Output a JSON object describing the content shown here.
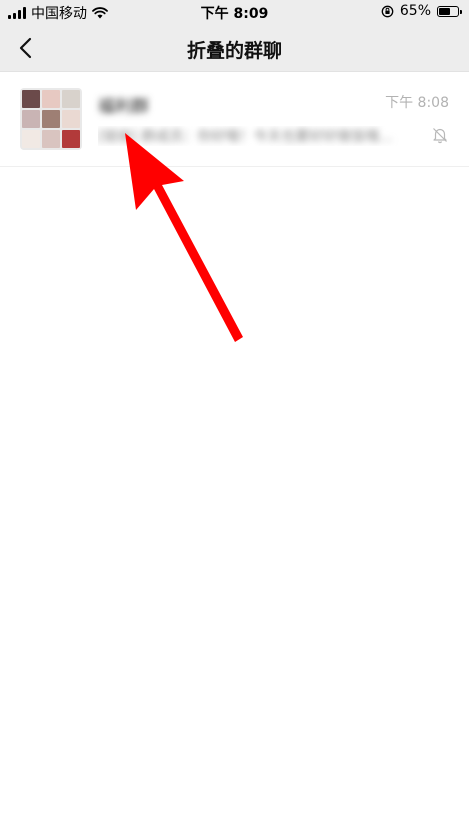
{
  "status_bar": {
    "carrier": "中国移动",
    "time": "下午 8:09",
    "battery": "65%",
    "battery_level": 0.65
  },
  "nav": {
    "title": "折叠的群聊",
    "back_icon": "chevron-left-icon"
  },
  "chat_list": [
    {
      "name": "福利群",
      "time": "下午 8:08",
      "preview": "[链接] 群成员：你好哦！今天也要好好做饭哦...",
      "muted": true,
      "avatar_colors": [
        "#6b4a4a",
        "#e7c9c2",
        "#d8d2cc",
        "#c9b4b4",
        "#9e7f74",
        "#ead9d2",
        "#f1e9e4",
        "#d9c4c0",
        "#b23a3a"
      ]
    }
  ],
  "annotation": {
    "type": "red-arrow",
    "color": "#ff0000"
  }
}
